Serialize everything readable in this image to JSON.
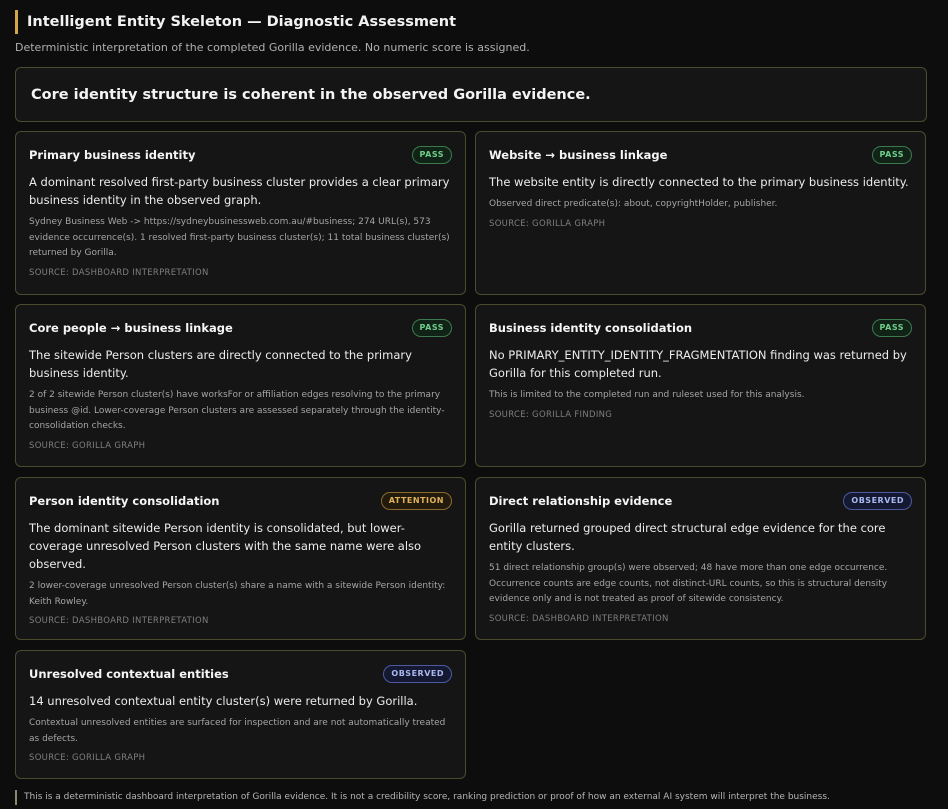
{
  "header": {
    "title": "Intelligent Entity Skeleton — Diagnostic Assessment",
    "subtitle": "Deterministic interpretation of the completed Gorilla evidence. No numeric score is assigned."
  },
  "summary": "Core identity structure is coherent in the observed Gorilla evidence.",
  "badge_colors": {
    "pass": "#6fcf8a",
    "attention": "#e0b35a",
    "observed": "#aab8f0"
  },
  "cards": [
    {
      "title": "Primary business identity",
      "badge": "PASS",
      "lead": "A dominant resolved first-party business cluster provides a clear primary business identity in the observed graph.",
      "detail": "Sydney Business Web -> https://sydneybusinessweb.com.au/#business; 274 URL(s), 573 evidence occurrence(s). 1 resolved first-party business cluster(s); 11 total business cluster(s) returned by Gorilla.",
      "source": "SOURCE: DASHBOARD INTERPRETATION"
    },
    {
      "title": "Website → business linkage",
      "badge": "PASS",
      "lead": "The website entity is directly connected to the primary business identity.",
      "detail": "Observed direct predicate(s): about, copyrightHolder, publisher.",
      "source": "SOURCE: GORILLA GRAPH"
    },
    {
      "title": "Core people → business linkage",
      "badge": "PASS",
      "lead": "The sitewide Person clusters are directly connected to the primary business identity.",
      "detail": "2 of 2 sitewide Person cluster(s) have worksFor or affiliation edges resolving to the primary business @id. Lower-coverage Person clusters are assessed separately through the identity-consolidation checks.",
      "source": "SOURCE: GORILLA GRAPH"
    },
    {
      "title": "Business identity consolidation",
      "badge": "PASS",
      "lead": "No PRIMARY_ENTITY_IDENTITY_FRAGMENTATION finding was returned by Gorilla for this completed run.",
      "detail": "This is limited to the completed run and ruleset used for this analysis.",
      "source": "SOURCE: GORILLA FINDING"
    },
    {
      "title": "Person identity consolidation",
      "badge": "ATTENTION",
      "lead": "The dominant sitewide Person identity is consolidated, but lower-coverage unresolved Person clusters with the same name were also observed.",
      "detail": "2 lower-coverage unresolved Person cluster(s) share a name with a sitewide Person identity: Keith Rowley.",
      "source": "SOURCE: DASHBOARD INTERPRETATION"
    },
    {
      "title": "Direct relationship evidence",
      "badge": "OBSERVED",
      "lead": "Gorilla returned grouped direct structural edge evidence for the core entity clusters.",
      "detail": "51 direct relationship group(s) were observed; 48 have more than one edge occurrence. Occurrence counts are edge counts, not distinct-URL counts, so this is structural density evidence only and is not treated as proof of sitewide consistency.",
      "source": "SOURCE: DASHBOARD INTERPRETATION"
    },
    {
      "title": "Unresolved contextual entities",
      "badge": "OBSERVED",
      "lead": "14 unresolved contextual entity cluster(s) were returned by Gorilla.",
      "detail": "Contextual unresolved entities are surfaced for inspection and are not automatically treated as defects.",
      "source": "SOURCE: GORILLA GRAPH"
    }
  ],
  "footer": "This is a deterministic dashboard interpretation of Gorilla evidence. It is not a credibility score, ranking prediction or proof of how an external AI system will interpret the business."
}
